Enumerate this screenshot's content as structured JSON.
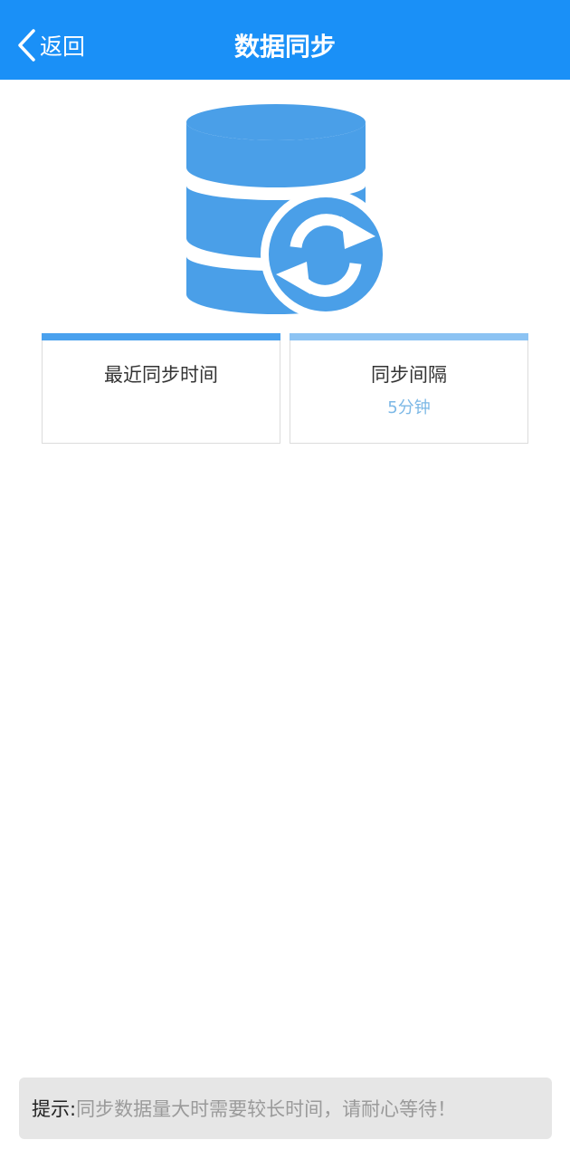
{
  "header": {
    "back_label": "返回",
    "title": "数据同步"
  },
  "icons": {
    "back": "chevron-left-icon",
    "hero": "database-sync-icon"
  },
  "cards": [
    {
      "label": "最近同步时间",
      "value": ""
    },
    {
      "label": "同步间隔",
      "value": "5分钟"
    }
  ],
  "tip": {
    "prefix": "提示:",
    "text": "同步数据量大时需要较长时间，请耐心等待！"
  },
  "colors": {
    "header_bg": "#1a90f7",
    "icon_blue": "#4a9fe8",
    "card_bar_left": "#4aa1ee",
    "card_bar_right": "#8cc3f3",
    "accent_text": "#7cb8e6"
  }
}
